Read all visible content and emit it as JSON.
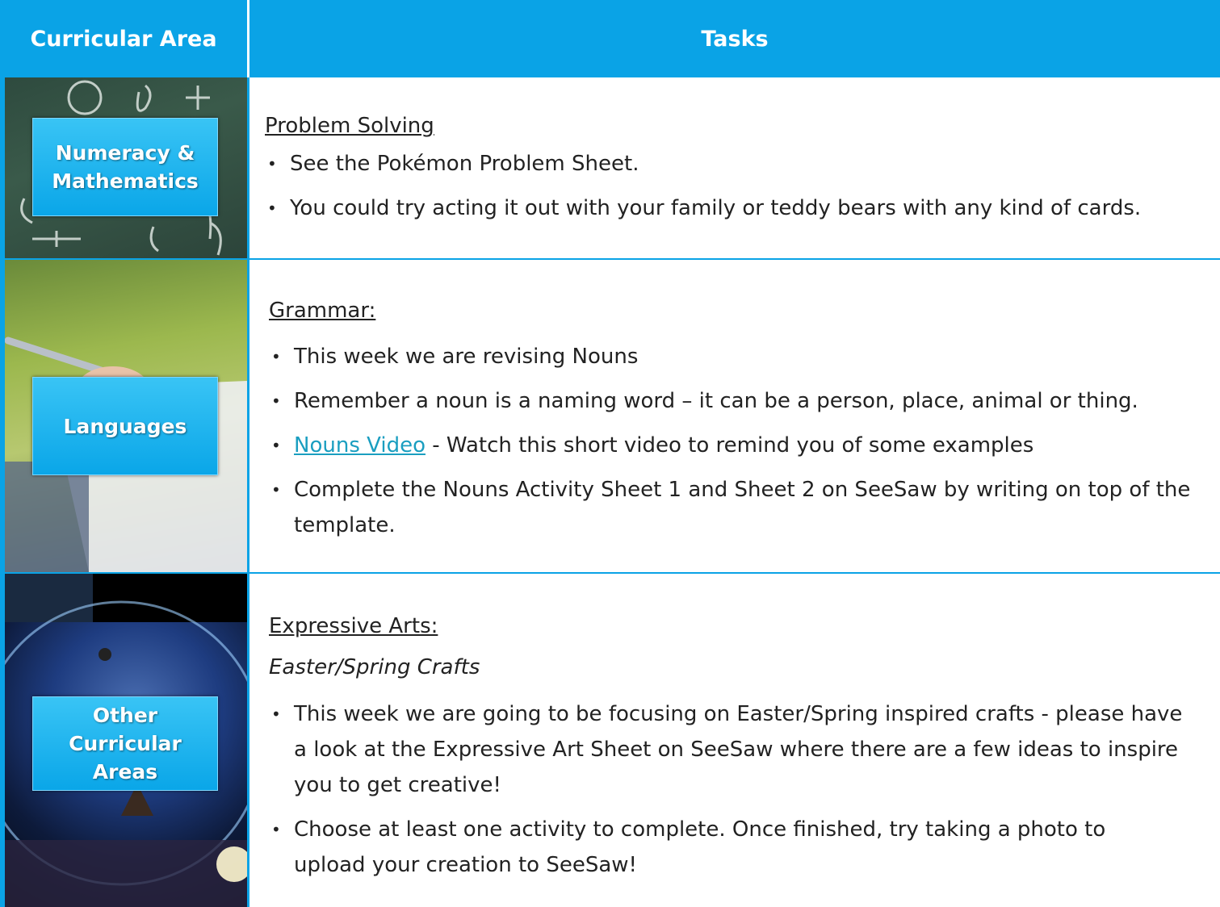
{
  "header": {
    "left": "Curricular Area",
    "right": "Tasks"
  },
  "rows": [
    {
      "label_lines": [
        "Numeracy &",
        "Mathematics"
      ],
      "heading": "Problem Solving",
      "bullets": [
        "See the Pokémon Problem Sheet.",
        "You could try acting it out with your family or teddy bears with any kind of cards."
      ]
    },
    {
      "label_lines": [
        "Languages"
      ],
      "heading": "Grammar:",
      "bullets": [
        "This week we are revising Nouns",
        "Remember a noun is a naming word – it can be a person, place, animal or thing.",
        "Complete the Nouns Activity Sheet 1 and Sheet 2 on SeeSaw by writing on top of the template."
      ],
      "link_bullet": {
        "link": "Nouns Video",
        "rest": " - Watch this short video to remind you of some examples"
      }
    },
    {
      "label_lines": [
        "Other",
        "Curricular",
        "Areas"
      ],
      "heading": "Expressive Arts: ",
      "subheading": "Easter/Spring Crafts",
      "bullets": [
        "This week we are going to be focusing on Easter/Spring inspired crafts -  please have a look at the Expressive Art Sheet on SeeSaw where there are a few ideas to inspire you to get creative!",
        "Choose at least one activity to complete. Once finished, try taking a photo to upload your creation to SeeSaw!"
      ]
    }
  ],
  "bullet_char": "•",
  "colors": {
    "header_bg": "#0aa3e6",
    "label_bg": "#1ab4f0",
    "link": "#1a9ec0"
  }
}
